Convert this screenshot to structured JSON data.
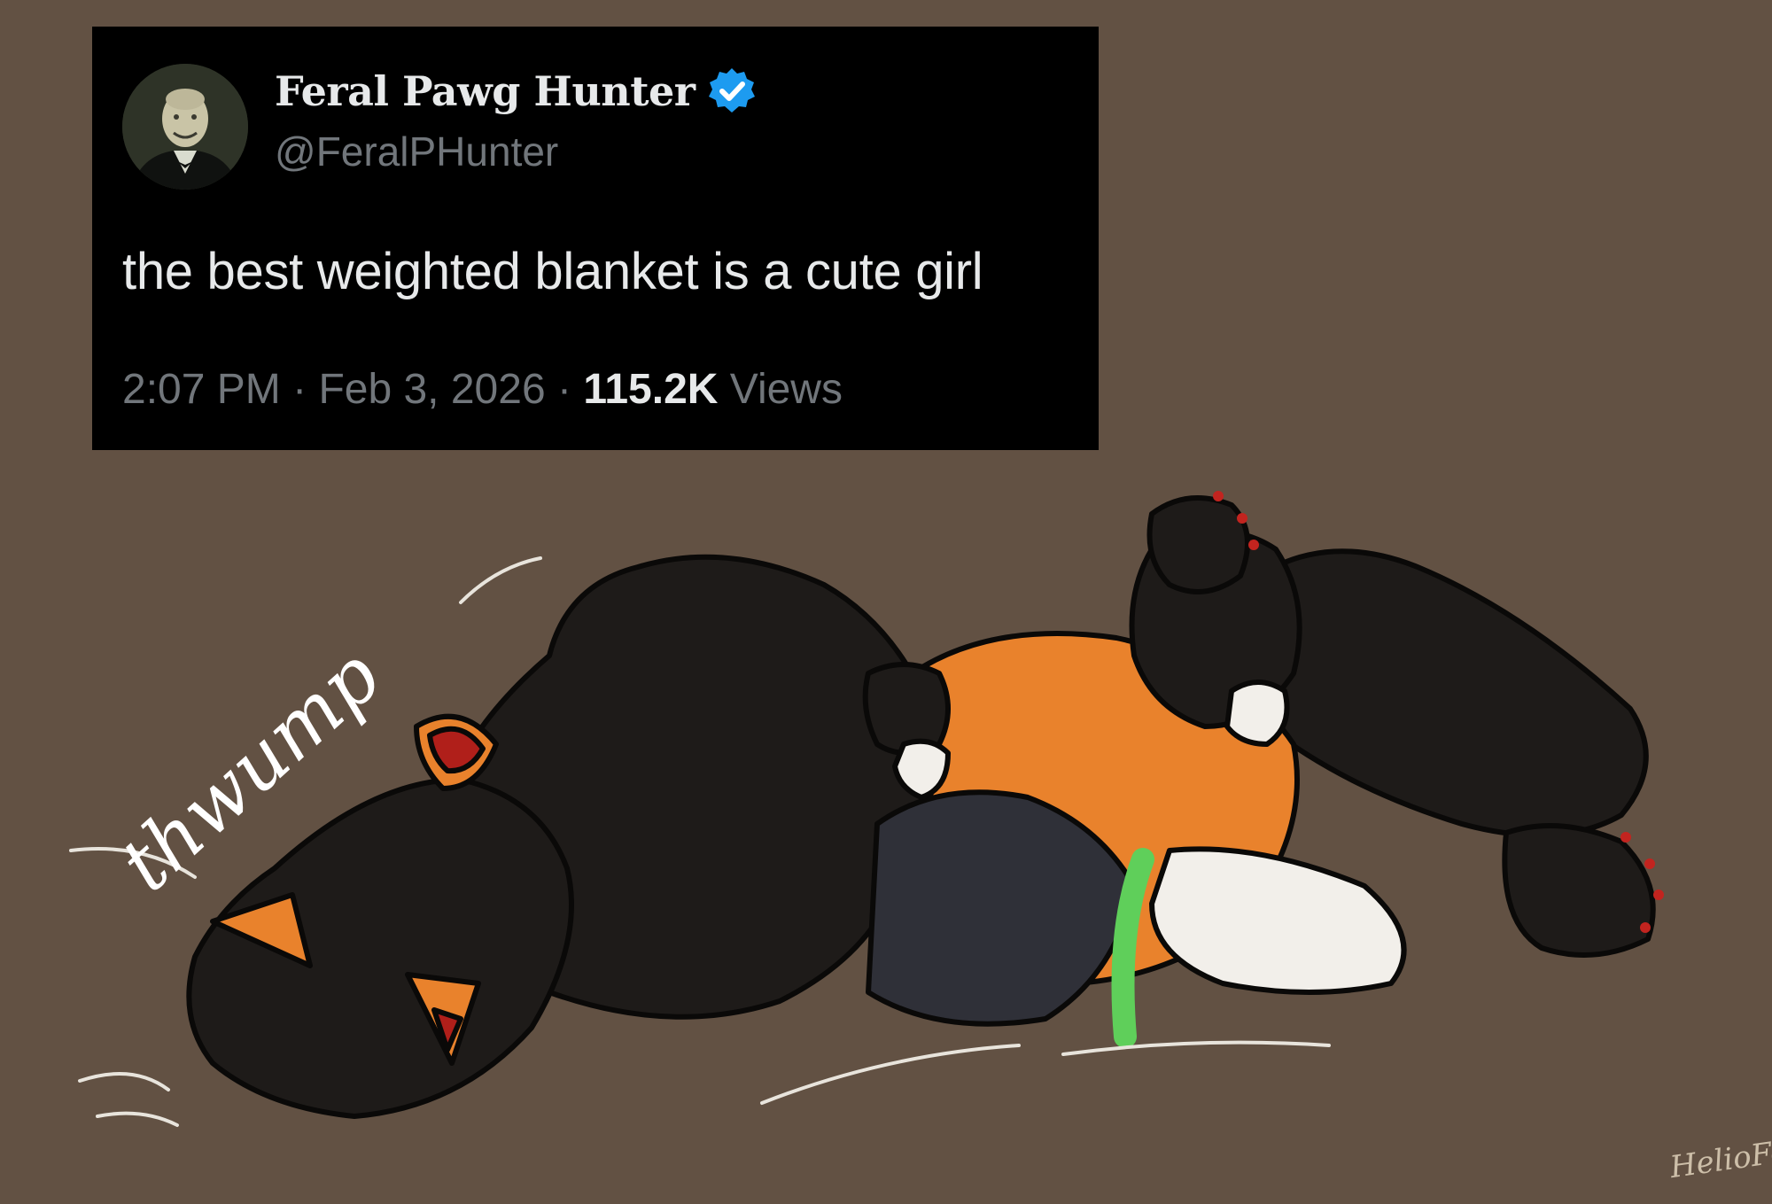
{
  "tweet": {
    "display_name": "Feral Pawg Hunter",
    "verified_icon": "verified-badge-icon",
    "handle": "@FeralPHunter",
    "text": "the best weighted blanket is a cute girl",
    "time": "2:07 PM",
    "date": "Feb 3, 2026",
    "views_count": "115.2K",
    "views_label": "Views",
    "separator": "·"
  },
  "illustration": {
    "sound_effect": "thwump",
    "signature": "HelioFox"
  },
  "colors": {
    "background": "#625143",
    "tweet_background": "#000000",
    "verified_blue": "#1d9bf0",
    "fur_black": "#1e1b19",
    "fur_orange": "#e9822c",
    "collar_green": "#5fcf5a",
    "claw_red": "#c2241f"
  }
}
